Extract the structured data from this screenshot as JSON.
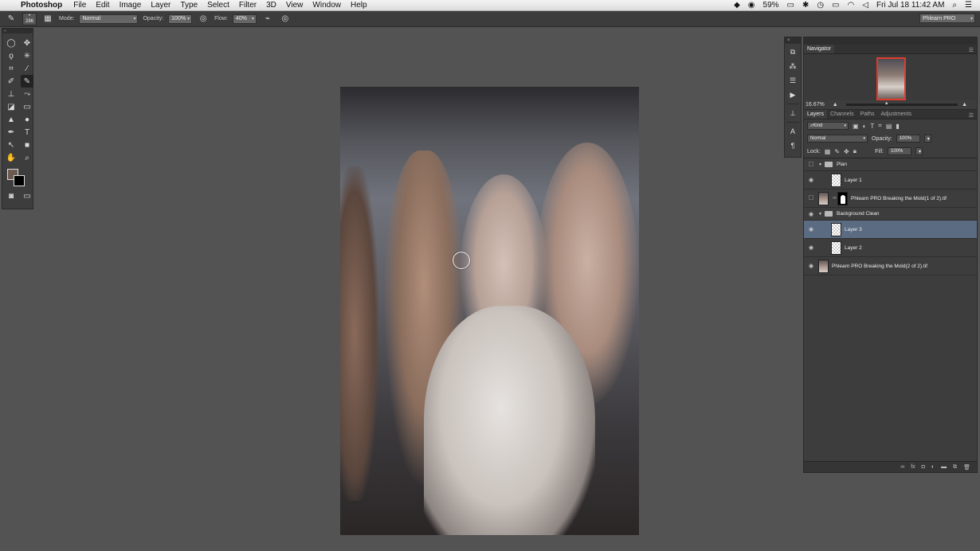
{
  "menubar": {
    "app_name": "Photoshop",
    "menus": [
      "File",
      "Edit",
      "Image",
      "Layer",
      "Type",
      "Select",
      "Filter",
      "3D",
      "View",
      "Window",
      "Help"
    ],
    "battery": "59%",
    "clock": "Fri Jul 18  11:42 AM"
  },
  "options": {
    "brush_size": "286",
    "mode_label": "Mode:",
    "mode_value": "Normal",
    "opacity_label": "Opacity:",
    "opacity_value": "100%",
    "flow_label": "Flow:",
    "flow_value": "40%",
    "workspace": "Phlearn PRO"
  },
  "colors": {
    "foreground": "#6d5a4f",
    "background": "#000000",
    "selected_layer": "#5a6b82",
    "navigator_frame": "#e03a2e"
  },
  "navigator": {
    "tab": "Navigator",
    "zoom": "16.67%"
  },
  "layers_panel": {
    "tabs": [
      "Layers",
      "Channels",
      "Paths",
      "Adjustments"
    ],
    "filter_kind": "Kind",
    "blend_mode": "Normal",
    "opacity_label": "Opacity:",
    "opacity_value": "100%",
    "lock_label": "Lock:",
    "fill_label": "Fill:",
    "fill_value": "100%",
    "layers": [
      {
        "name": "Plan",
        "type": "group",
        "visible": false
      },
      {
        "name": "Layer 1",
        "type": "layer",
        "visible": true
      },
      {
        "name": "Phlearn PRO Breaking the Mold(1 of 2).tif",
        "type": "masked",
        "visible": false
      },
      {
        "name": "Background Clean",
        "type": "group",
        "visible": true
      },
      {
        "name": "Layer 3",
        "type": "layer",
        "visible": true,
        "selected": true
      },
      {
        "name": "Layer 2",
        "type": "layer",
        "visible": true
      },
      {
        "name": "Phlearn PRO Breaking the Mold(2 of 2).tif",
        "type": "photo",
        "visible": true
      }
    ]
  }
}
